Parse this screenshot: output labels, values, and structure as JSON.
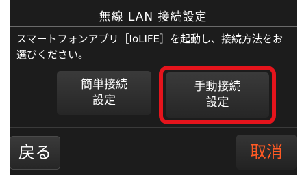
{
  "screen": {
    "title": "無線 LAN 接続設定",
    "message": "スマートフォンアプリ［IoLIFE］を起動し、接続方法をお選びください。"
  },
  "buttons": {
    "easy_line1": "簡単接続",
    "easy_line2": "設定",
    "manual_line1": "手動接続",
    "manual_line2": "設定",
    "back": "戻る",
    "cancel": "取消"
  },
  "colors": {
    "highlight": "#e5141c",
    "cancel_text": "#ff5a24"
  }
}
